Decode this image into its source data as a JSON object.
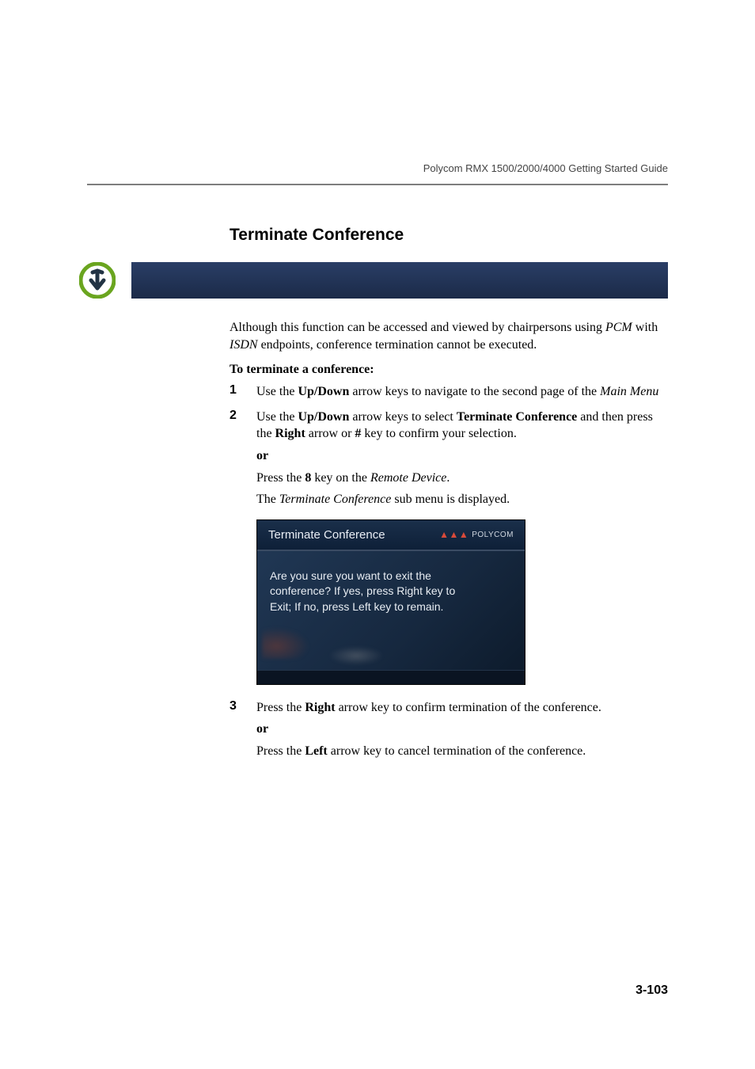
{
  "running_head": "Polycom RMX 1500/2000/4000 Getting Started Guide",
  "heading": "Terminate Conference",
  "intro_pre": "Although this function can be accessed and viewed by chairpersons using ",
  "intro_pcm": "PCM",
  "intro_mid": " with ",
  "intro_isdn": "ISDN",
  "intro_post": " endpoints, conference termination cannot be executed.",
  "proc_title": "To terminate a conference:",
  "steps": {
    "s1": {
      "num": "1",
      "a": "Use the ",
      "b": "Up/Down",
      "c": " arrow keys to navigate to the second page of the ",
      "d": "Main Menu"
    },
    "s2": {
      "num": "2",
      "a": "Use the ",
      "b": "Up/Down",
      "c": " arrow keys to select ",
      "d": "Terminate Conference",
      "e": " and then press the ",
      "f": "Right",
      "g": " arrow or ",
      "h": "#",
      "i": " key to confirm your selection.",
      "or": "or",
      "j": "Press the ",
      "k": "8",
      "l": " key on the ",
      "m": "Remote Device",
      "n": ".",
      "o": "The ",
      "p": "Terminate Conference",
      "q": " sub menu is displayed."
    },
    "s3": {
      "num": "3",
      "a": "Press the ",
      "b": "Right",
      "c": " arrow key to confirm termination of the conference.",
      "or": "or",
      "d": "Press the ",
      "e": "Left",
      "f": " arrow key to cancel termination of the conference."
    }
  },
  "screenshot": {
    "title": "Terminate Conference",
    "brand": "POLYCOM",
    "line1": "Are you sure you want to exit the",
    "line2": "conference? If yes, press Right key to",
    "line3": "Exit; If no, press Left key to remain."
  },
  "page_number": "3-103"
}
